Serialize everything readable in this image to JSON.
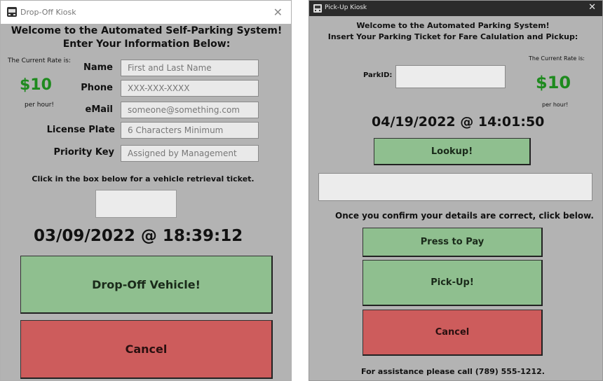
{
  "dropoff": {
    "title": "Drop-Off Kiosk",
    "close_glyph": "✕",
    "welcome_line1": "Welcome to the Automated Self-Parking System!",
    "welcome_line2": "Enter Your Information Below:",
    "rate_label": "The Current Rate is:",
    "rate_value": "$10",
    "rate_unit": "per hour!",
    "fields": [
      {
        "label": "Name",
        "placeholder": "First and Last Name"
      },
      {
        "label": "Phone",
        "placeholder": "XXX-XXX-XXXX"
      },
      {
        "label": "eMail",
        "placeholder": "someone@something.com"
      },
      {
        "label": "License Plate",
        "placeholder": "6 Characters Minimum"
      },
      {
        "label": "Priority Key",
        "placeholder": "Assigned by Management"
      }
    ],
    "ticket_instruction": "Click in the box below for a vehicle retrieval ticket.",
    "datetime": "03/09/2022 @ 18:39:12",
    "dropoff_button": "Drop-Off Vehicle!",
    "cancel_button": "Cancel"
  },
  "pickup": {
    "title": "Pick-Up Kiosk",
    "close_glyph": "✕",
    "welcome_line1": "Welcome to the Automated Parking System!",
    "welcome_line2": "Insert Your Parking Ticket for Fare Calulation and Pickup:",
    "parkid_label": "ParkID:",
    "rate_label": "The Current Rate is:",
    "rate_value": "$10",
    "rate_unit": "per hour!",
    "datetime": "04/19/2022 @ 14:01:50",
    "lookup_button": "Lookup!",
    "confirm_text": "Once you confirm your details are correct, click below.",
    "pay_button": "Press to Pay",
    "pickup_button": "Pick-Up!",
    "cancel_button": "Cancel",
    "assistance": "For assistance please call (789) 555-1212."
  },
  "colors": {
    "window_bg": "#b3b3b3",
    "green_button": "#8fbf8f",
    "red_button": "#cd5c5c",
    "price_green": "#1e8a1e"
  },
  "icons": {
    "app": "kiosk-app-icon",
    "close": "close-icon"
  }
}
